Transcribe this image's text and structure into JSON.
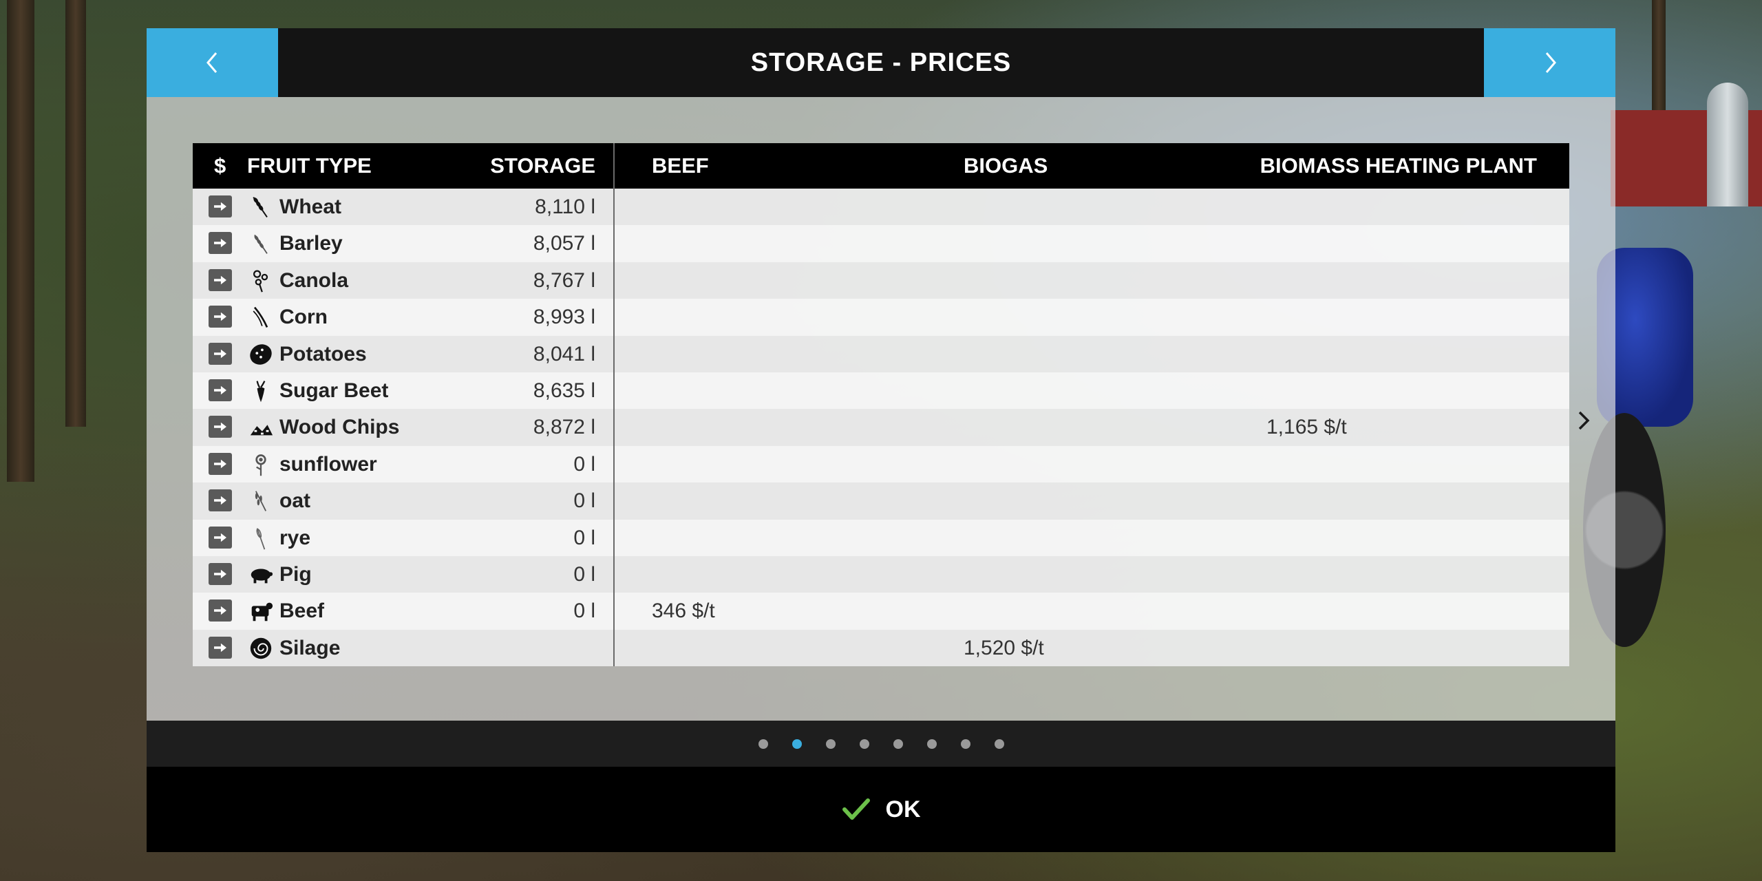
{
  "dialog": {
    "title": "STORAGE - PRICES",
    "prev_icon": "chevron-left-icon",
    "next_icon": "chevron-right-icon",
    "accent_color": "#3aaedf"
  },
  "table": {
    "headers": {
      "dollar": "$",
      "fruit_type": "FRUIT TYPE",
      "storage": "STORAGE",
      "beef": "BEEF",
      "biogas": "BIOGAS",
      "biomass": "BIOMASS HEATING PLANT"
    },
    "rows": [
      {
        "icon": "wheat-icon",
        "name": "Wheat",
        "storage": "8,110 l",
        "beef": "",
        "biogas": "",
        "biomass": ""
      },
      {
        "icon": "barley-icon",
        "name": "Barley",
        "storage": "8,057 l",
        "beef": "",
        "biogas": "",
        "biomass": ""
      },
      {
        "icon": "canola-icon",
        "name": "Canola",
        "storage": "8,767 l",
        "beef": "",
        "biogas": "",
        "biomass": ""
      },
      {
        "icon": "corn-icon",
        "name": "Corn",
        "storage": "8,993 l",
        "beef": "",
        "biogas": "",
        "biomass": ""
      },
      {
        "icon": "potatoes-icon",
        "name": "Potatoes",
        "storage": "8,041 l",
        "beef": "",
        "biogas": "",
        "biomass": ""
      },
      {
        "icon": "sugar-beet-icon",
        "name": "Sugar Beet",
        "storage": "8,635 l",
        "beef": "",
        "biogas": "",
        "biomass": ""
      },
      {
        "icon": "wood-chips-icon",
        "name": "Wood Chips",
        "storage": "8,872 l",
        "beef": "",
        "biogas": "",
        "biomass": "1,165 $/t"
      },
      {
        "icon": "sunflower-icon",
        "name": "sunflower",
        "storage": "0 l",
        "beef": "",
        "biogas": "",
        "biomass": ""
      },
      {
        "icon": "oat-icon",
        "name": "oat",
        "storage": "0 l",
        "beef": "",
        "biogas": "",
        "biomass": ""
      },
      {
        "icon": "rye-icon",
        "name": "rye",
        "storage": "0 l",
        "beef": "",
        "biogas": "",
        "biomass": ""
      },
      {
        "icon": "pig-icon",
        "name": "Pig",
        "storage": "0 l",
        "beef": "",
        "biogas": "",
        "biomass": ""
      },
      {
        "icon": "cow-icon",
        "name": "Beef",
        "storage": "0 l",
        "beef": "346 $/t",
        "biogas": "",
        "biomass": ""
      },
      {
        "icon": "silage-icon",
        "name": "Silage",
        "storage": "",
        "beef": "",
        "biogas": "1,520 $/t",
        "biomass": ""
      }
    ],
    "sell_icon": "arrow-right-icon",
    "scroll_icon": "chevron-right-icon"
  },
  "pager": {
    "pages": 8,
    "active_index": 1
  },
  "footer": {
    "ok_label": "OK",
    "ok_icon": "checkmark-icon",
    "ok_icon_color": "#6cc04a"
  }
}
